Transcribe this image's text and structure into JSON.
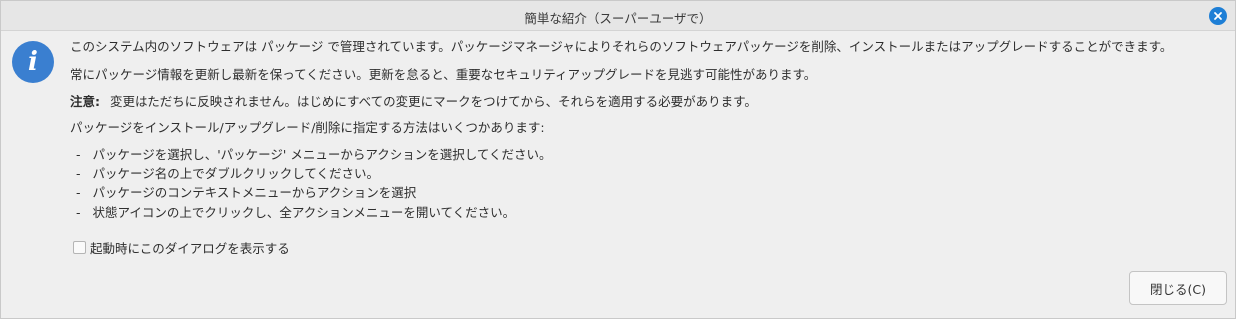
{
  "window": {
    "title": "簡単な紹介（スーパーユーザで）"
  },
  "icons": {
    "info": "i",
    "close": "close-icon"
  },
  "message": {
    "line1": "このシステム内のソフトウェアは パッケージ で管理されています。パッケージマネージャによりそれらのソフトウェアパッケージを削除、インストールまたはアップグレードすることができます。",
    "line2": "常にパッケージ情報を更新し最新を保ってください。更新を怠ると、重要なセキュリティアップグレードを見逃す可能性があります。",
    "note_label": "注意:",
    "note_text": "変更はただちに反映されません。はじめにすべての変更にマークをつけてから、それらを適用する必要があります。",
    "methods_intro": "パッケージをインストール/アップグレード/削除に指定する方法はいくつかあります:",
    "methods": [
      "パッケージを選択し、'パッケージ' メニューからアクションを選択してください。",
      "パッケージ名の上でダブルクリックしてください。",
      "パッケージのコンテキストメニューからアクションを選択",
      "状態アイコンの上でクリックし、全アクションメニューを開いてください。"
    ],
    "bullet_mark": "-"
  },
  "options": {
    "show_on_startup_label": "起動時にこのダイアログを表示する",
    "show_on_startup_checked": false
  },
  "buttons": {
    "close_label": "閉じる(C)"
  },
  "colors": {
    "accent": "#1e7fd6",
    "info_icon": "#3a7fd0"
  }
}
